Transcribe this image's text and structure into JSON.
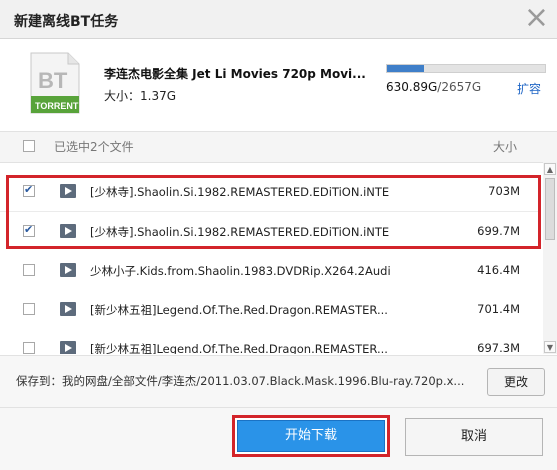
{
  "dialog": {
    "title": "新建离线BT任务",
    "close_icon": "close-icon"
  },
  "torrent": {
    "icon_text": "BT",
    "icon_label": "TORRENT",
    "file_title": "李连杰电影全集 Jet Li Movies 720p Movi...",
    "size_label": "大小：",
    "size_value": "1.37G"
  },
  "quota": {
    "used": "630.89G",
    "separator": "/",
    "total": "2657G",
    "used_fraction": 0.237,
    "expand_label": "扩容",
    "bar_color": "#3f7fc9"
  },
  "list_header": {
    "selected_text": "已选中2个文件",
    "size_header": "大小"
  },
  "files": [
    {
      "name": "[少林寺].Shaolin.Si.1982.REMASTERED.EDiTiON.iNTE...",
      "size": "703M",
      "checked": true
    },
    {
      "name": "[少林寺].Shaolin.Si.1982.REMASTERED.EDiTiON.iNTE...",
      "size": "699.7M",
      "checked": true
    },
    {
      "name": "少林小子.Kids.from.Shaolin.1983.DVDRip.X264.2Audi...",
      "size": "416.4M",
      "checked": false
    },
    {
      "name": "[新少林五祖]Legend.Of.The.Red.Dragon.REMASTER...",
      "size": "701.4M",
      "checked": false
    },
    {
      "name": "[新少林五祖]Legend.Of.The.Red.Dragon.REMASTER...",
      "size": "697.3M",
      "checked": false
    }
  ],
  "save": {
    "label": "保存到：",
    "path": "我的网盘/全部文件/李连杰/2011.03.07.Black.Mask.1996.Blu-ray.720p.x...",
    "change_button": "更改"
  },
  "actions": {
    "start_button": "开始下载",
    "cancel_button": "取消"
  },
  "colors": {
    "accent": "#2a93e8",
    "highlight": "#d3242a"
  }
}
